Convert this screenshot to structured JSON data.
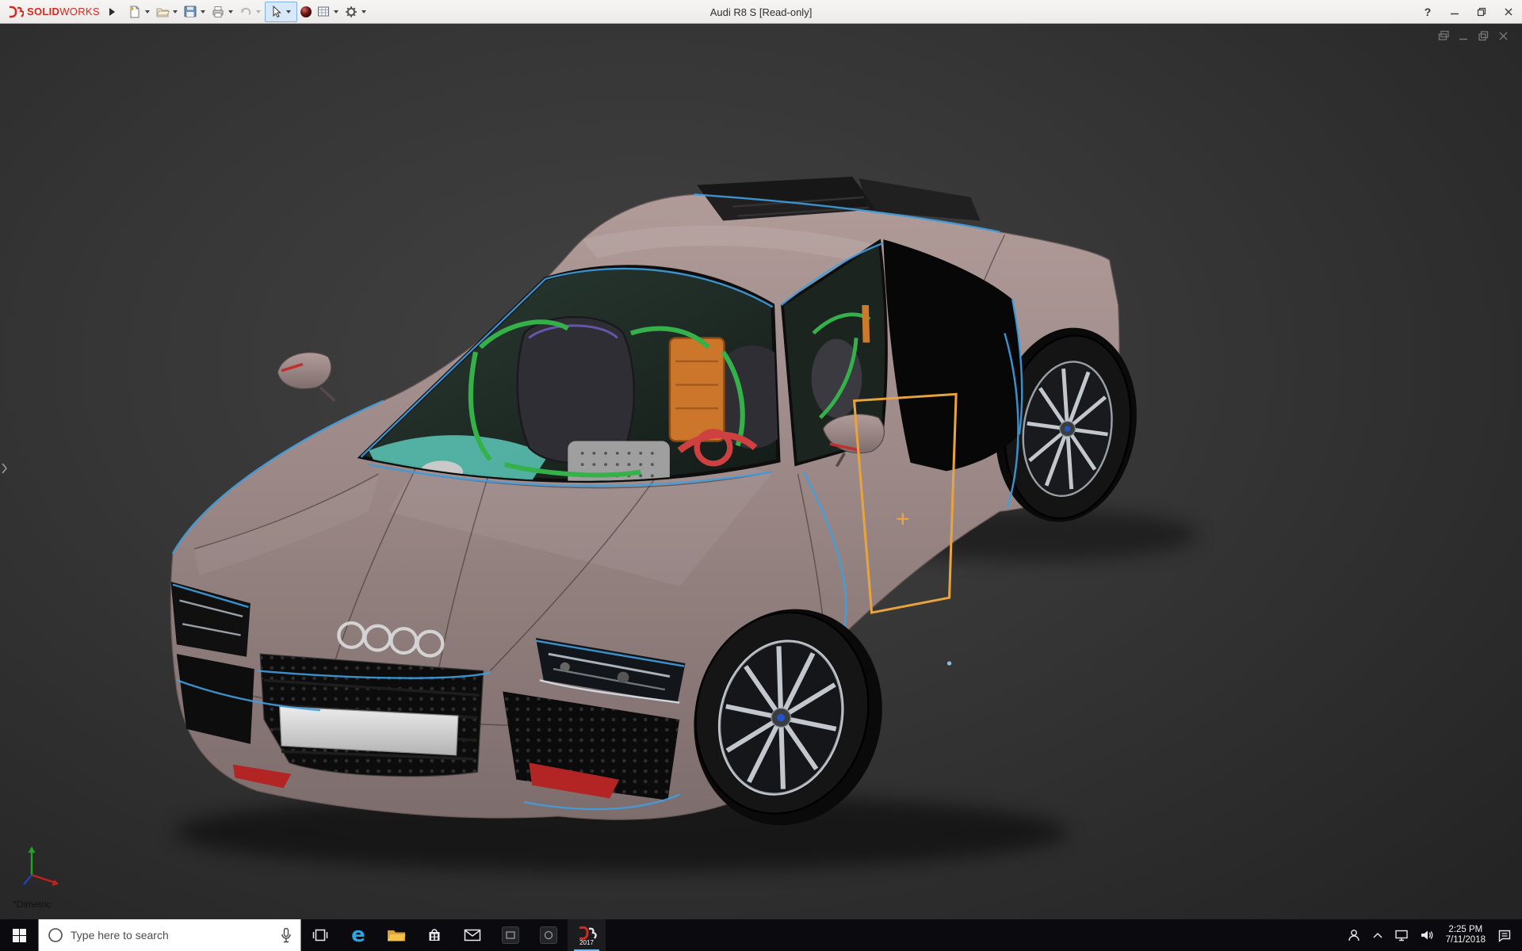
{
  "titlebar": {
    "brand_bold": "SOLID",
    "brand_light": "WORKS",
    "document_title": "Audi R8 S [Read-only]",
    "help_glyph": "?",
    "toolbar_buttons": [
      "new-document",
      "open",
      "save",
      "print",
      "undo",
      "select",
      "appearance",
      "design-table",
      "options"
    ]
  },
  "viewport": {
    "view_label": "*Dimetric",
    "model": "Audi R8 coupe 3D model, dimetric view",
    "colors": {
      "background_center": "#424242",
      "background_edge": "#242424",
      "body": "#9b8887",
      "edge_highlight_blue": "#3f9fe0",
      "sketch_orange": "#e8a33d",
      "cage_green": "#35b14a",
      "interior_teal": "#5cc9b8",
      "accent_red": "#b32424"
    }
  },
  "taskbar": {
    "search_placeholder": "Type here to search",
    "apps": [
      "task-view",
      "edge",
      "file-explorer",
      "store",
      "mail",
      "pinned-app-1",
      "pinned-app-2",
      "solidworks-2017"
    ],
    "solidworks_year": "2017",
    "tray_icons": [
      "people",
      "hidden-icons",
      "network",
      "volume",
      "clock",
      "action-center"
    ],
    "tray": {
      "time": "2:25 PM",
      "date": "7/11/2018"
    }
  },
  "icons": {
    "edge_letter": "e"
  }
}
